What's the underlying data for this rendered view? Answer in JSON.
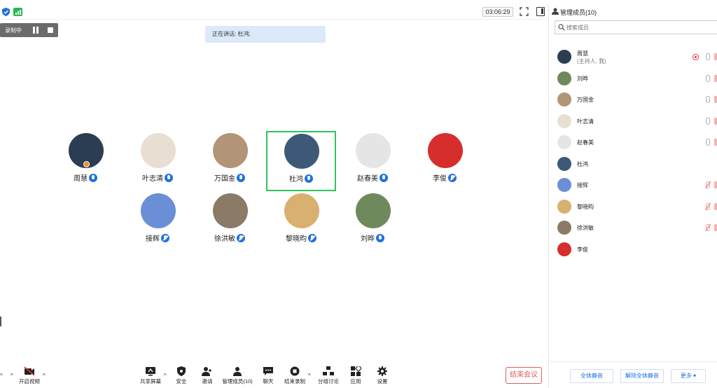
{
  "meeting": {
    "timer": "03:06:29",
    "recording_label": "录制中",
    "speaking_text": "正在讲话: 杜鸿;"
  },
  "participants": [
    {
      "name": "周慧",
      "mic": "on",
      "host": true,
      "avatar_color": "#2b3d52"
    },
    {
      "name": "叶志清",
      "mic": "on",
      "host": false,
      "avatar_color": "#e8dfd2"
    },
    {
      "name": "万国金",
      "mic": "on",
      "host": false,
      "avatar_color": "#b29478"
    },
    {
      "name": "杜鸿",
      "mic": "on",
      "host": false,
      "avatar_color": "#3c5a78",
      "active": true
    },
    {
      "name": "赵春美",
      "mic": "on",
      "host": false,
      "avatar_color": "#e5e5e5"
    },
    {
      "name": "李俊",
      "mic": "muted",
      "host": false,
      "avatar_color": "#d62d2d"
    },
    {
      "name": "接辉",
      "mic": "muted",
      "host": false,
      "avatar_color": "#6b8fd6"
    },
    {
      "name": "徐洪敏",
      "mic": "muted",
      "host": false,
      "avatar_color": "#8a7a66"
    },
    {
      "name": "黎晓昀",
      "mic": "muted",
      "host": false,
      "avatar_color": "#d8b070"
    },
    {
      "name": "刘晔",
      "mic": "on",
      "host": false,
      "avatar_color": "#6e8a5c"
    }
  ],
  "toolbar": {
    "video": "开启视频",
    "share": "共享屏幕",
    "security": "安全",
    "invite": "邀请",
    "manage": "管理成员(10)",
    "chat": "聊天",
    "end_record": "结束录制",
    "breakout": "分组讨论",
    "apps": "应用",
    "settings": "设置",
    "end_meeting": "结束会议"
  },
  "panel": {
    "title": "管理成员(10)",
    "search_placeholder": "搜索成员",
    "members": [
      {
        "name": "周慧",
        "sub": "(主持人, 我)",
        "mic": "gray",
        "rec": true,
        "avatar_color": "#2b3d52"
      },
      {
        "name": "刘晔",
        "mic": "gray",
        "avatar_color": "#6e8a5c"
      },
      {
        "name": "万国金",
        "mic": "gray",
        "avatar_color": "#b29478"
      },
      {
        "name": "叶志清",
        "mic": "gray",
        "avatar_color": "#e8dfd2"
      },
      {
        "name": "赵春美",
        "mic": "gray",
        "avatar_color": "#e5e5e5"
      },
      {
        "name": "杜鸿",
        "mic": "none",
        "avatar_color": "#3c5a78"
      },
      {
        "name": "接辉",
        "mic": "red",
        "avatar_color": "#6b8fd6"
      },
      {
        "name": "黎晓昀",
        "mic": "red",
        "avatar_color": "#d8b070"
      },
      {
        "name": "徐洪敏",
        "mic": "red",
        "avatar_color": "#8a7a66"
      },
      {
        "name": "李俊",
        "mic": "none",
        "avatar_color": "#d62d2d"
      }
    ],
    "mute_all": "全体静音",
    "unmute_all": "解除全体静音",
    "more": "更多 ▾"
  },
  "colors": {
    "accent": "#1f6fe0",
    "active_border": "#2ec45a",
    "end_red": "#e05a5a"
  }
}
